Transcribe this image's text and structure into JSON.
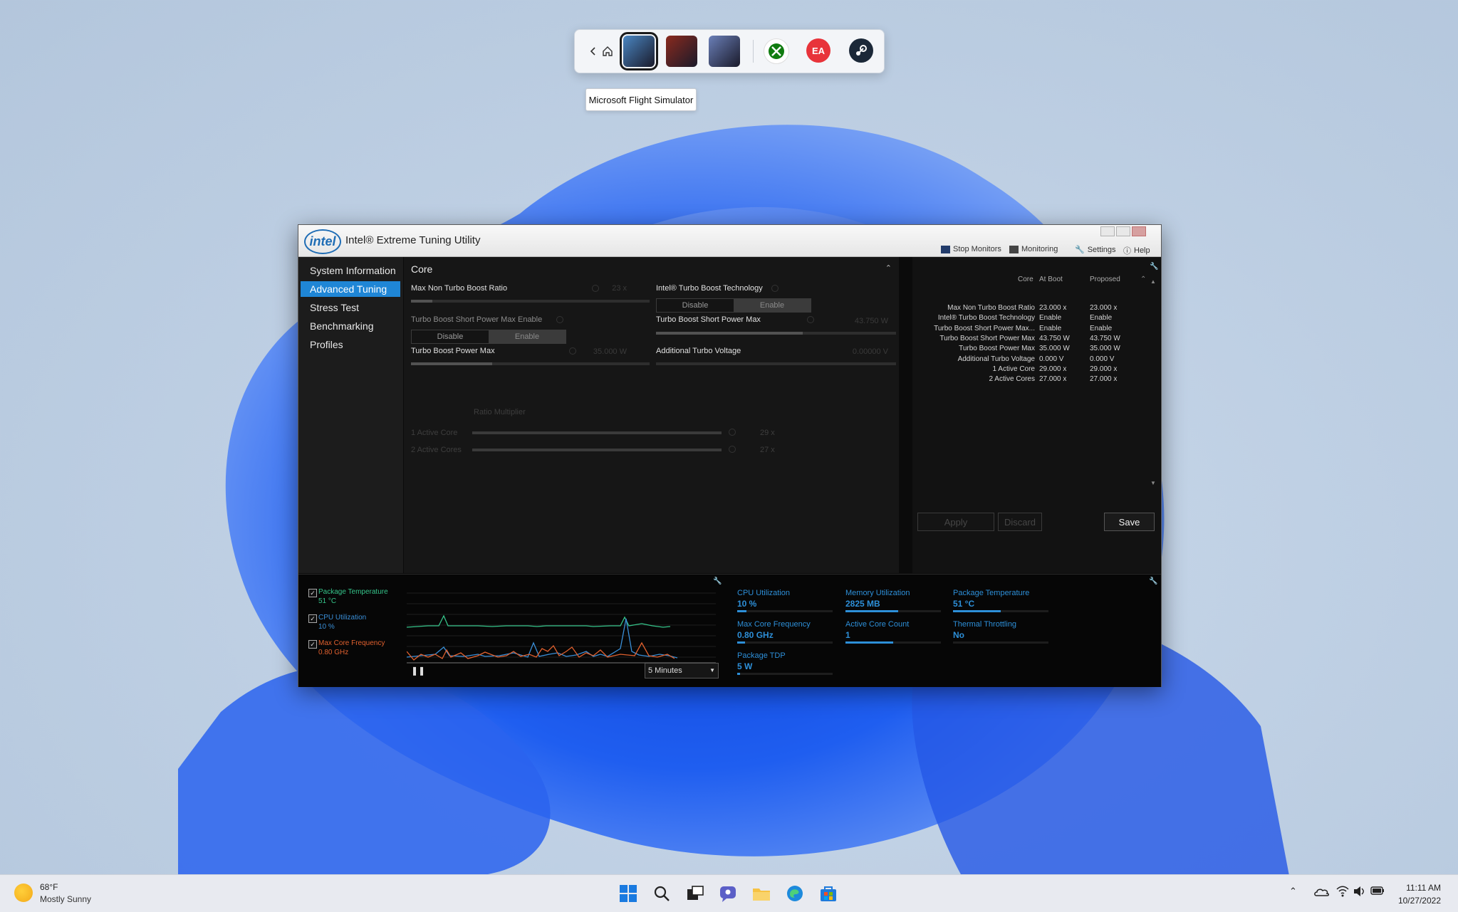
{
  "launcher": {
    "games": [
      {
        "name": "flight-simulator-tile",
        "color": "#4a86c2"
      },
      {
        "name": "game-tile-2",
        "color": "#8a2a1e"
      },
      {
        "name": "forza-horizon-tile",
        "color": "#6a7fb8"
      }
    ],
    "tooltip": "Microsoft Flight Simulator",
    "stores": [
      "xbox-icon",
      "ea-icon",
      "steam-icon"
    ],
    "ea_text": "EA"
  },
  "app": {
    "title": "Intel® Extreme Tuning Utility",
    "logo_text": "intel",
    "toolbar": {
      "stop_monitors": "Stop Monitors",
      "monitoring": "Monitoring",
      "settings": "Settings",
      "help": "Help"
    }
  },
  "nav": {
    "items": [
      "System Information",
      "Advanced Tuning",
      "Stress Test",
      "Benchmarking",
      "Profiles"
    ],
    "active": "Advanced Tuning"
  },
  "core": {
    "title": "Core",
    "max_non_turbo": {
      "label": "Max Non Turbo Boost Ratio",
      "value": "23 x",
      "fraction": 0.09
    },
    "turbo_boost_tech": {
      "label": "Intel® Turbo Boost Technology",
      "off": "Disable",
      "on": "Enable",
      "selected": "Enable"
    },
    "short_power_enable": {
      "label": "Turbo Boost Short Power Max Enable",
      "off": "Disable",
      "on": "Enable",
      "selected": "Enable"
    },
    "short_power_max": {
      "label": "Turbo Boost Short Power Max",
      "value": "43.750 W",
      "fraction": 0.61
    },
    "power_max": {
      "label": "Turbo Boost Power Max",
      "value": "35.000 W",
      "fraction": 0.34
    },
    "additional_voltage": {
      "label": "Additional Turbo Voltage",
      "value": "0.00000 V",
      "fraction": 0.0
    },
    "ratio_multiplier": "Ratio Multiplier",
    "active_cores": [
      {
        "label": "1 Active Core",
        "value": "29 x"
      },
      {
        "label": "2 Active Cores",
        "value": "27 x"
      }
    ]
  },
  "summary": {
    "headers": {
      "name": "Core",
      "at_boot": "At Boot",
      "proposed": "Proposed"
    },
    "rows": [
      {
        "name": "Max Non Turbo Boost Ratio",
        "at_boot": "23.000 x",
        "proposed": "23.000 x"
      },
      {
        "name": "Intel® Turbo Boost Technology",
        "at_boot": "Enable",
        "proposed": "Enable"
      },
      {
        "name": "Turbo Boost Short Power Max...",
        "at_boot": "Enable",
        "proposed": "Enable"
      },
      {
        "name": "Turbo Boost Short Power Max",
        "at_boot": "43.750 W",
        "proposed": "43.750 W"
      },
      {
        "name": "Turbo Boost Power Max",
        "at_boot": "35.000 W",
        "proposed": "35.000 W"
      },
      {
        "name": "Additional Turbo Voltage",
        "at_boot": "0.000 V",
        "proposed": "0.000 V"
      },
      {
        "name": "1 Active Core",
        "at_boot": "29.000 x",
        "proposed": "29.000 x"
      },
      {
        "name": "2 Active Cores",
        "at_boot": "27.000 x",
        "proposed": "27.000 x"
      }
    ],
    "apply": "Apply",
    "discard": "Discard",
    "save": "Save"
  },
  "monitor": {
    "legend": [
      {
        "label": "Package Temperature",
        "value": "51 °C",
        "color": "#35c48a"
      },
      {
        "label": "CPU Utilization",
        "value": "10 %",
        "color": "#3a8fd8"
      },
      {
        "label": "Max Core Frequency",
        "value": "0.80 GHz",
        "color": "#e0602e"
      }
    ],
    "interval": "5 Minutes",
    "stats": [
      {
        "name": "CPU Utilization",
        "value": "10 %",
        "fraction": 0.1
      },
      {
        "name": "Memory Utilization",
        "value": "2825  MB",
        "fraction": 0.55
      },
      {
        "name": "Package Temperature",
        "value": "51 °C",
        "fraction": 0.5
      },
      {
        "name": "Max Core Frequency",
        "value": "0.80 GHz",
        "fraction": 0.08
      },
      {
        "name": "Active Core Count",
        "value": "1",
        "fraction": 0.5
      },
      {
        "name": "Thermal Throttling",
        "value": "No",
        "fraction": 0.0
      },
      {
        "name": "Package TDP",
        "value": "5 W",
        "fraction": 0.03
      }
    ]
  },
  "taskbar": {
    "temp": "68°F",
    "condition": "Mostly Sunny",
    "time": "11:11 AM",
    "date": "10/27/2022"
  }
}
